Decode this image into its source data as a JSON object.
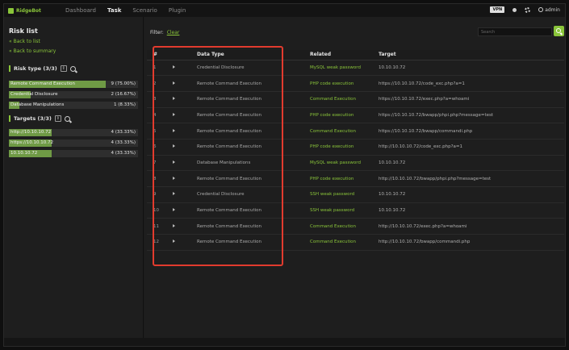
{
  "app": {
    "logo": "RidgeBot"
  },
  "nav": {
    "items": [
      {
        "label": "Dashboard",
        "active": false
      },
      {
        "label": "Task",
        "active": true
      },
      {
        "label": "Scenario",
        "active": false
      },
      {
        "label": "Plugin",
        "active": false
      }
    ]
  },
  "topright": {
    "vpn": "VPN",
    "user": "admin"
  },
  "sidebar": {
    "title": "Risk list",
    "back_to_list": "« Back to list",
    "back_to_summary": "« Back to summary",
    "risk_type": {
      "title": "Risk type (3/3)",
      "items": [
        {
          "label": "Remote Command Execution",
          "value": "9 (75.00%)",
          "fill": 0.75
        },
        {
          "label": "Credential Disclosure",
          "value": "2 (16.67%)",
          "fill": 0.1667
        },
        {
          "label": "Database Manipulations",
          "value": "1 (8.33%)",
          "fill": 0.0833
        }
      ]
    },
    "targets": {
      "title": "Targets (3/3)",
      "items": [
        {
          "label": "http://10.10.10.72",
          "value": "4 (33.33%)",
          "fill": 0.3333
        },
        {
          "label": "https://10.10.10.72",
          "value": "4 (33.33%)",
          "fill": 0.3333
        },
        {
          "label": "10.10.10.72",
          "value": "4 (33.33%)",
          "fill": 0.3333
        }
      ]
    }
  },
  "main": {
    "filter_label": "Filter:",
    "clear_label": "Clear",
    "search_placeholder": "Search",
    "columns": [
      "#",
      "",
      "Data Type",
      "Related",
      "Target"
    ],
    "rows": [
      {
        "n": "1",
        "type": "Credential Disclosure",
        "related": "MySQL weak password",
        "target": "10.10.10.72"
      },
      {
        "n": "2",
        "type": "Remote Command Execution",
        "related": "PHP code execution",
        "target": "https://10.10.10.72/code_exc.php?a=1"
      },
      {
        "n": "3",
        "type": "Remote Command Execution",
        "related": "Command Execution",
        "target": "https://10.10.10.72/exec.php?a=whoami"
      },
      {
        "n": "4",
        "type": "Remote Command Execution",
        "related": "PHP code execution",
        "target": "https://10.10.10.72/bwapp/phpi.php?message=test"
      },
      {
        "n": "5",
        "type": "Remote Command Execution",
        "related": "Command Execution",
        "target": "https://10.10.10.72/bwapp/commandi.php"
      },
      {
        "n": "6",
        "type": "Remote Command Execution",
        "related": "PHP code execution",
        "target": "http://10.10.10.72/code_exc.php?a=1"
      },
      {
        "n": "7",
        "type": "Database Manipulations",
        "related": "MySQL weak password",
        "target": "10.10.10.72"
      },
      {
        "n": "8",
        "type": "Remote Command Execution",
        "related": "PHP code execution",
        "target": "http://10.10.10.72/bwapp/phpi.php?message=test"
      },
      {
        "n": "9",
        "type": "Credential Disclosure",
        "related": "SSH weak password",
        "target": "10.10.10.72"
      },
      {
        "n": "10",
        "type": "Remote Command Execution",
        "related": "SSH weak password",
        "target": "10.10.10.72"
      },
      {
        "n": "11",
        "type": "Remote Command Execution",
        "related": "Command Execution",
        "target": "http://10.10.10.72/exec.php?a=whoami"
      },
      {
        "n": "12",
        "type": "Remote Command Execution",
        "related": "Command Execution",
        "target": "http://10.10.10.72/bwapp/commandi.php"
      }
    ]
  },
  "colors": {
    "accent": "#8ac53a",
    "bar_fill": "#6f9a45",
    "highlight": "#e23b2e"
  }
}
